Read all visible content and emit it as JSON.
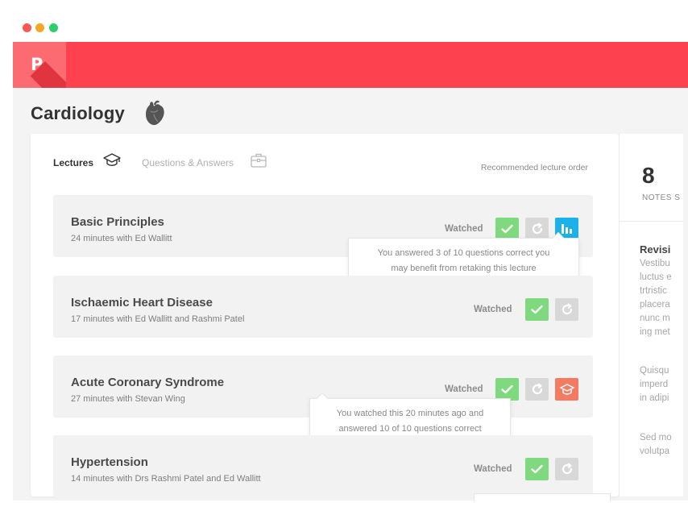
{
  "window": {
    "controls": [
      "close",
      "minimize",
      "maximize"
    ]
  },
  "app": {
    "logo_letter": "P",
    "brand_color": "#fe414e"
  },
  "page": {
    "title": "Cardiology",
    "title_icon": "heart-icon"
  },
  "tabs": [
    {
      "label": "Lectures",
      "icon": "graduation-cap-icon",
      "active": true
    },
    {
      "label": "Questions & Answers",
      "icon": "briefcase-icon",
      "active": false
    }
  ],
  "recommended_label": "Recommended lecture order",
  "lectures": [
    {
      "title": "Basic Principles",
      "subtitle": "24 minutes with Ed Wallitt",
      "status": "Watched",
      "extra_button": "bar-chart-icon",
      "tooltip": [
        "You answered 3 of 10 questions correct you",
        "may benefit from retaking this lecture"
      ]
    },
    {
      "title": "Ischaemic Heart Disease",
      "subtitle": "17 minutes with Ed Wallitt and Rashmi Patel",
      "status": "Watched"
    },
    {
      "title": "Acute Coronary Syndrome",
      "subtitle": "27 minutes with Stevan Wing",
      "status": "Watched",
      "extra_button": "graduation-cap-icon",
      "tooltip": [
        "You watched this 20 minutes ago and",
        "answered 10 of 10 questions correct"
      ]
    },
    {
      "title": "Hypertension",
      "subtitle": "14 minutes with Drs Rashmi Patel and Ed Wallitt",
      "status": "Watched"
    }
  ],
  "sidebar": {
    "stat_number": "8",
    "stat_label": "NOTES S",
    "heading": "Revisi",
    "paragraph1": [
      "Vestibu",
      "luctus e",
      "trtristic",
      "placera",
      "nunc m",
      "ing met"
    ],
    "paragraph2": [
      "Quisqu",
      "imperd",
      "in adipi"
    ],
    "paragraph3": [
      "Sed mo",
      "volutpa"
    ]
  },
  "colors": {
    "watched_check": "#7fd97f",
    "replay": "#d8d8d8",
    "stats_button": "#1ab2e8",
    "quiz_button": "#f47b61"
  }
}
